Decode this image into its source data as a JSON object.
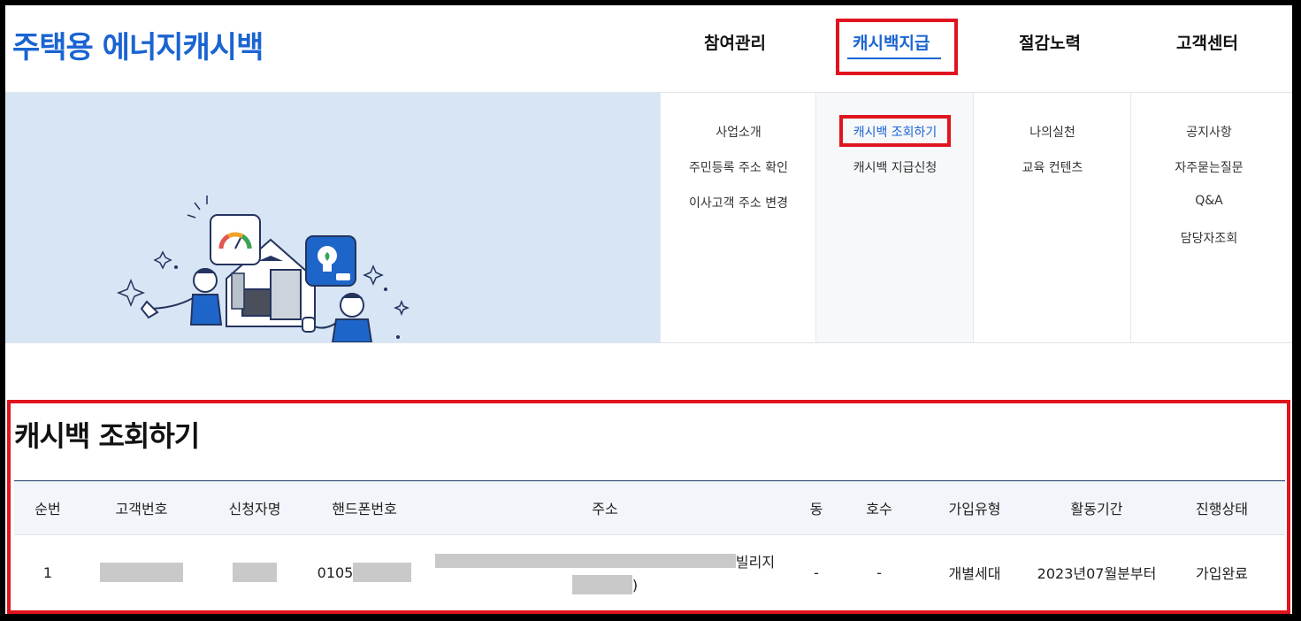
{
  "header": {
    "logo": "주택용 에너지캐시백",
    "nav": [
      {
        "label": "참여관리"
      },
      {
        "label": "캐시백지급"
      },
      {
        "label": "절감노력"
      },
      {
        "label": "고객센터"
      }
    ]
  },
  "menu": {
    "columns": [
      {
        "items": [
          "사업소개",
          "주민등록 주소 확인",
          "이사고객 주소 변경"
        ]
      },
      {
        "items": [
          "캐시백 조회하기",
          "캐시백 지급신청"
        ]
      },
      {
        "items": [
          "나의실천",
          "교육 컨텐츠"
        ]
      },
      {
        "items": [
          "공지사항",
          "자주묻는질문",
          "Q&A",
          "담당자조회"
        ]
      }
    ]
  },
  "content": {
    "title": "캐시백 조회하기",
    "table": {
      "headers": [
        "순번",
        "고객번호",
        "신청자명",
        "핸드폰번호",
        "주소",
        "동",
        "호수",
        "가입유형",
        "활동기간",
        "진행상태"
      ],
      "rows": [
        {
          "no": "1",
          "customer_no": "",
          "name": "",
          "phone_prefix": "0105",
          "address_line1_suffix": "빌리지",
          "address_line2_suffix": ")",
          "dong": "-",
          "ho": "-",
          "join_type": "개별세대",
          "period": "2023년07월분부터",
          "status": "가입완료"
        }
      ]
    }
  },
  "colors": {
    "accent": "#1a64d2",
    "highlight": "#e0141e",
    "banner_bg": "#d7e5f5"
  }
}
